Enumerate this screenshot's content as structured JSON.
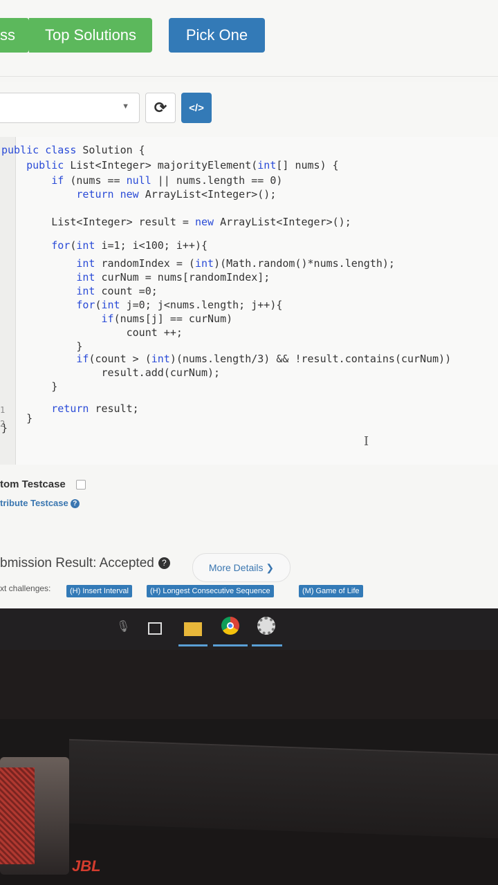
{
  "header": {
    "partial_button_label": "ss",
    "top_solutions_label": "Top Solutions",
    "pick_one_label": "Pick One"
  },
  "toolbar": {
    "language_select_value": "",
    "refresh_icon": "refresh-icon",
    "code_icon": "code-icon",
    "code_glyph": "</>"
  },
  "editor": {
    "gutter_numbers": [
      "1",
      "2"
    ],
    "lines": [
      "public class Solution {",
      "    public List<Integer> majorityElement(int[] nums) {",
      "        if (nums == null || nums.length == 0)",
      "            return new ArrayList<Integer>();",
      "",
      "        List<Integer> result = new ArrayList<Integer>();",
      "",
      "        for(int i=1; i<100; i++){",
      "            int randomIndex = (int)(Math.random()*nums.length);",
      "            int curNum = nums[randomIndex];",
      "            int count =0;",
      "            for(int j=0; j<nums.length; j++){",
      "                if(nums[j] == curNum)",
      "                    count ++;",
      "            }",
      "            if(count > (int)(nums.length/3) && !result.contains(curNum))",
      "                result.add(curNum);",
      "        }",
      "",
      "        return result;",
      "    }",
      "}"
    ]
  },
  "testcase": {
    "custom_label": "tom Testcase",
    "contribute_label": "tribute Testcase"
  },
  "submission": {
    "result_text": "bmission Result: Accepted",
    "more_details_label": "More Details ❯",
    "next_label": "xt challenges:",
    "challenges": [
      "(H) Insert Interval",
      "(H) Longest Consecutive Sequence",
      "(M) Game of Life"
    ]
  },
  "device": {
    "brand": "JBL"
  }
}
